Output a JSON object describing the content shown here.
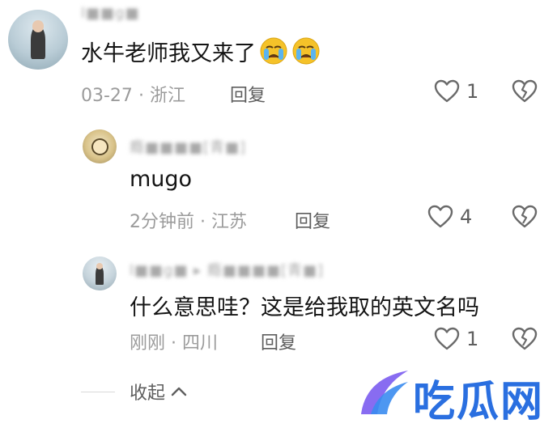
{
  "comments": [
    {
      "username": "l■■g■",
      "text": "水牛老师我又来了",
      "date": "03-27",
      "location": "浙江",
      "reply_label": "回复",
      "likes": "1"
    },
    {
      "username": "瘾■■■■[青■]",
      "text": "mugo",
      "date": "2分钟前",
      "location": "江苏",
      "reply_label": "回复",
      "likes": "4"
    },
    {
      "username": "l■■g■ ▸ 瘾■■■■[青■]",
      "text": "什么意思哇？这是给我取的英文名吗",
      "date": "刚刚",
      "location": "四川",
      "reply_label": "回复",
      "likes": "1"
    }
  ],
  "separator": "·",
  "collapse_label": "收起",
  "watermark_text": "吃瓜网",
  "colors": {
    "accent": "#2a6fe0",
    "meta": "#9b9b9b",
    "emoji": "#f5c229",
    "tears": "#5ab4f0"
  },
  "icons": [
    "heart-outline-icon",
    "broken-heart-icon",
    "chevron-up-icon",
    "crying-emoji-icon"
  ]
}
